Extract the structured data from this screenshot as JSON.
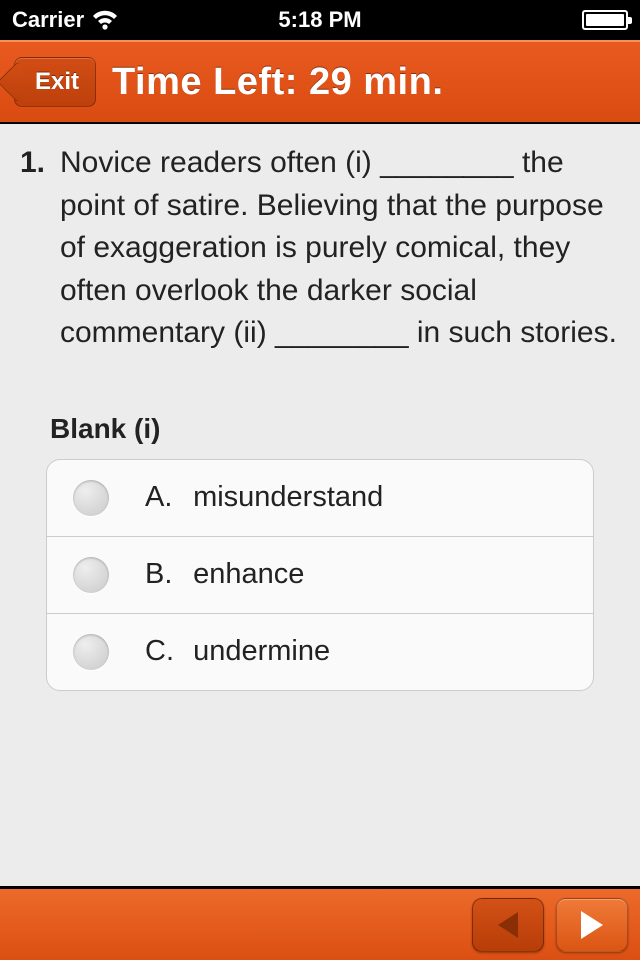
{
  "status": {
    "carrier": "Carrier",
    "time": "5:18 PM"
  },
  "nav": {
    "exit_label": "Exit",
    "title": "Time Left: 29 min."
  },
  "question": {
    "number": "1.",
    "text": "Novice readers often (i) ________ the point of satire. Believing that the purpose of exaggeration is purely comical, they often overlook the darker social commentary (ii) ________ in such stories."
  },
  "blank": {
    "header": "Blank (i)",
    "options": [
      {
        "letter": "A.",
        "text": "misunderstand"
      },
      {
        "letter": "B.",
        "text": "enhance"
      },
      {
        "letter": "C.",
        "text": "undermine"
      }
    ]
  },
  "colors": {
    "accent": "#e35a1b"
  }
}
